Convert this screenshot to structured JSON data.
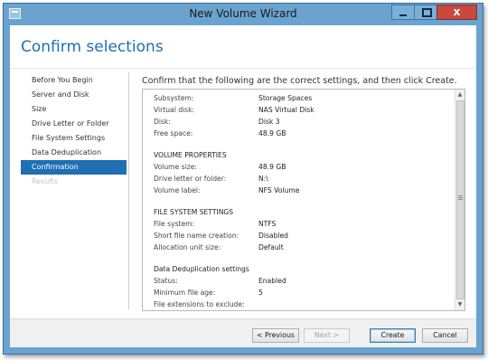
{
  "window": {
    "title": "New Volume Wizard",
    "close_glyph": "x"
  },
  "page": {
    "title": "Confirm selections",
    "instruction": "Confirm that the following are the correct settings, and then click Create."
  },
  "nav": {
    "items": [
      {
        "label": "Before You Begin",
        "state": "normal"
      },
      {
        "label": "Server and Disk",
        "state": "normal"
      },
      {
        "label": "Size",
        "state": "normal"
      },
      {
        "label": "Drive Letter or Folder",
        "state": "normal"
      },
      {
        "label": "File System Settings",
        "state": "normal"
      },
      {
        "label": "Data Deduplication",
        "state": "normal"
      },
      {
        "label": "Confirmation",
        "state": "active"
      },
      {
        "label": "Results",
        "state": "disabled"
      }
    ]
  },
  "summary": {
    "top_rows": [
      {
        "label": "Subsystem:",
        "value": "Storage Spaces"
      },
      {
        "label": "Virtual disk:",
        "value": "NAS Virtual Disk"
      },
      {
        "label": "Disk:",
        "value": "Disk 3"
      },
      {
        "label": "Free space:",
        "value": "48.9 GB"
      }
    ],
    "volume_heading": "VOLUME PROPERTIES",
    "volume_rows": [
      {
        "label": "Volume size:",
        "value": "48.9 GB"
      },
      {
        "label": "Drive letter or folder:",
        "value": "N:\\"
      },
      {
        "label": "Volume label:",
        "value": "NFS Volume"
      }
    ],
    "fs_heading": "FILE SYSTEM SETTINGS",
    "fs_rows": [
      {
        "label": "File system:",
        "value": "NTFS"
      },
      {
        "label": "Short file name creation:",
        "value": "Disabled"
      },
      {
        "label": "Allocation unit size:",
        "value": "Default"
      }
    ],
    "dedup_heading": "Data Deduplication settings",
    "dedup_rows": [
      {
        "label": "Status:",
        "value": "Enabled"
      },
      {
        "label": "Minimum file age:",
        "value": "5"
      },
      {
        "label": "File extensions to exclude:",
        "value": ""
      }
    ],
    "scroll_up": "▲",
    "scroll_down": "▼"
  },
  "buttons": {
    "previous": "< Previous",
    "next": "Next >",
    "create": "Create",
    "cancel": "Cancel"
  },
  "colors": {
    "title_bar": "#6aa3cf",
    "accent": "#1f6fb2",
    "close_button": "#c7493f"
  }
}
